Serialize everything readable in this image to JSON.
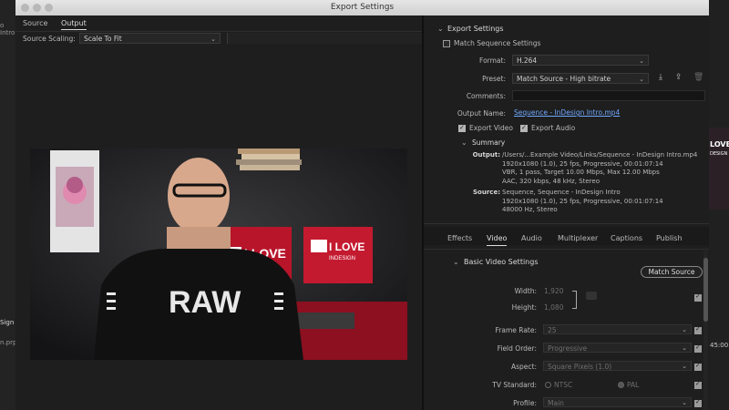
{
  "window": {
    "title": "Export Settings"
  },
  "source_tabs": [
    {
      "label": "Source"
    },
    {
      "label": "Output"
    }
  ],
  "source_scaling": {
    "label": "Source Scaling:",
    "value": "Scale To Fit"
  },
  "export_settings": {
    "heading": "Export Settings",
    "match_sequence": "Match Sequence Settings",
    "format_label": "Format:",
    "format_value": "H.264",
    "preset_label": "Preset:",
    "preset_value": "Match Source - High bitrate",
    "comments_label": "Comments:",
    "output_name_label": "Output Name:",
    "output_name_value": "Sequence - InDesign Intro.mp4",
    "export_video": "Export Video",
    "export_audio": "Export Audio"
  },
  "summary": {
    "heading": "Summary",
    "output_label": "Output:",
    "output_lines": [
      "/Users/...Example Video/Links/Sequence - InDesign Intro.mp4",
      "1920x1080 (1.0), 25 fps, Progressive, 00:01:07:14",
      "VBR, 1 pass, Target 10.00 Mbps, Max 12.00 Mbps",
      "AAC, 320 kbps, 48 kHz, Stereo"
    ],
    "source_label": "Source:",
    "source_lines": [
      "Sequence, Sequence - InDesign Intro",
      "1920x1080 (1.0), 25 fps, Progressive, 00:01:07:14",
      "48000 Hz, Stereo"
    ]
  },
  "subtabs": [
    {
      "label": "Effects"
    },
    {
      "label": "Video"
    },
    {
      "label": "Audio"
    },
    {
      "label": "Multiplexer"
    },
    {
      "label": "Captions"
    },
    {
      "label": "Publish"
    }
  ],
  "video": {
    "heading": "Basic Video Settings",
    "match_source": "Match Source",
    "width_label": "Width:",
    "width_value": "1,920",
    "height_label": "Height:",
    "height_value": "1,080",
    "frame_rate_label": "Frame Rate:",
    "frame_rate_value": "25",
    "field_order_label": "Field Order:",
    "field_order_value": "Progressive",
    "aspect_label": "Aspect:",
    "aspect_value": "Square Pixels (1.0)",
    "tv_standard_label": "TV Standard:",
    "ntsc": "NTSC",
    "pal": "PAL",
    "profile_label": "Profile:",
    "profile_value": "Main"
  },
  "preview": {
    "poster_line1": "I LOVE",
    "poster_line2": "INDESIGN",
    "shirt_text": "RAW"
  },
  "background_app": {
    "left_text_1": "o Intro",
    "left_text_2": "Sign",
    "left_text_3": "n.prp",
    "right_text_1": "LOVE",
    "right_text_2": "DESIGN",
    "right_text_3": "45:00"
  }
}
